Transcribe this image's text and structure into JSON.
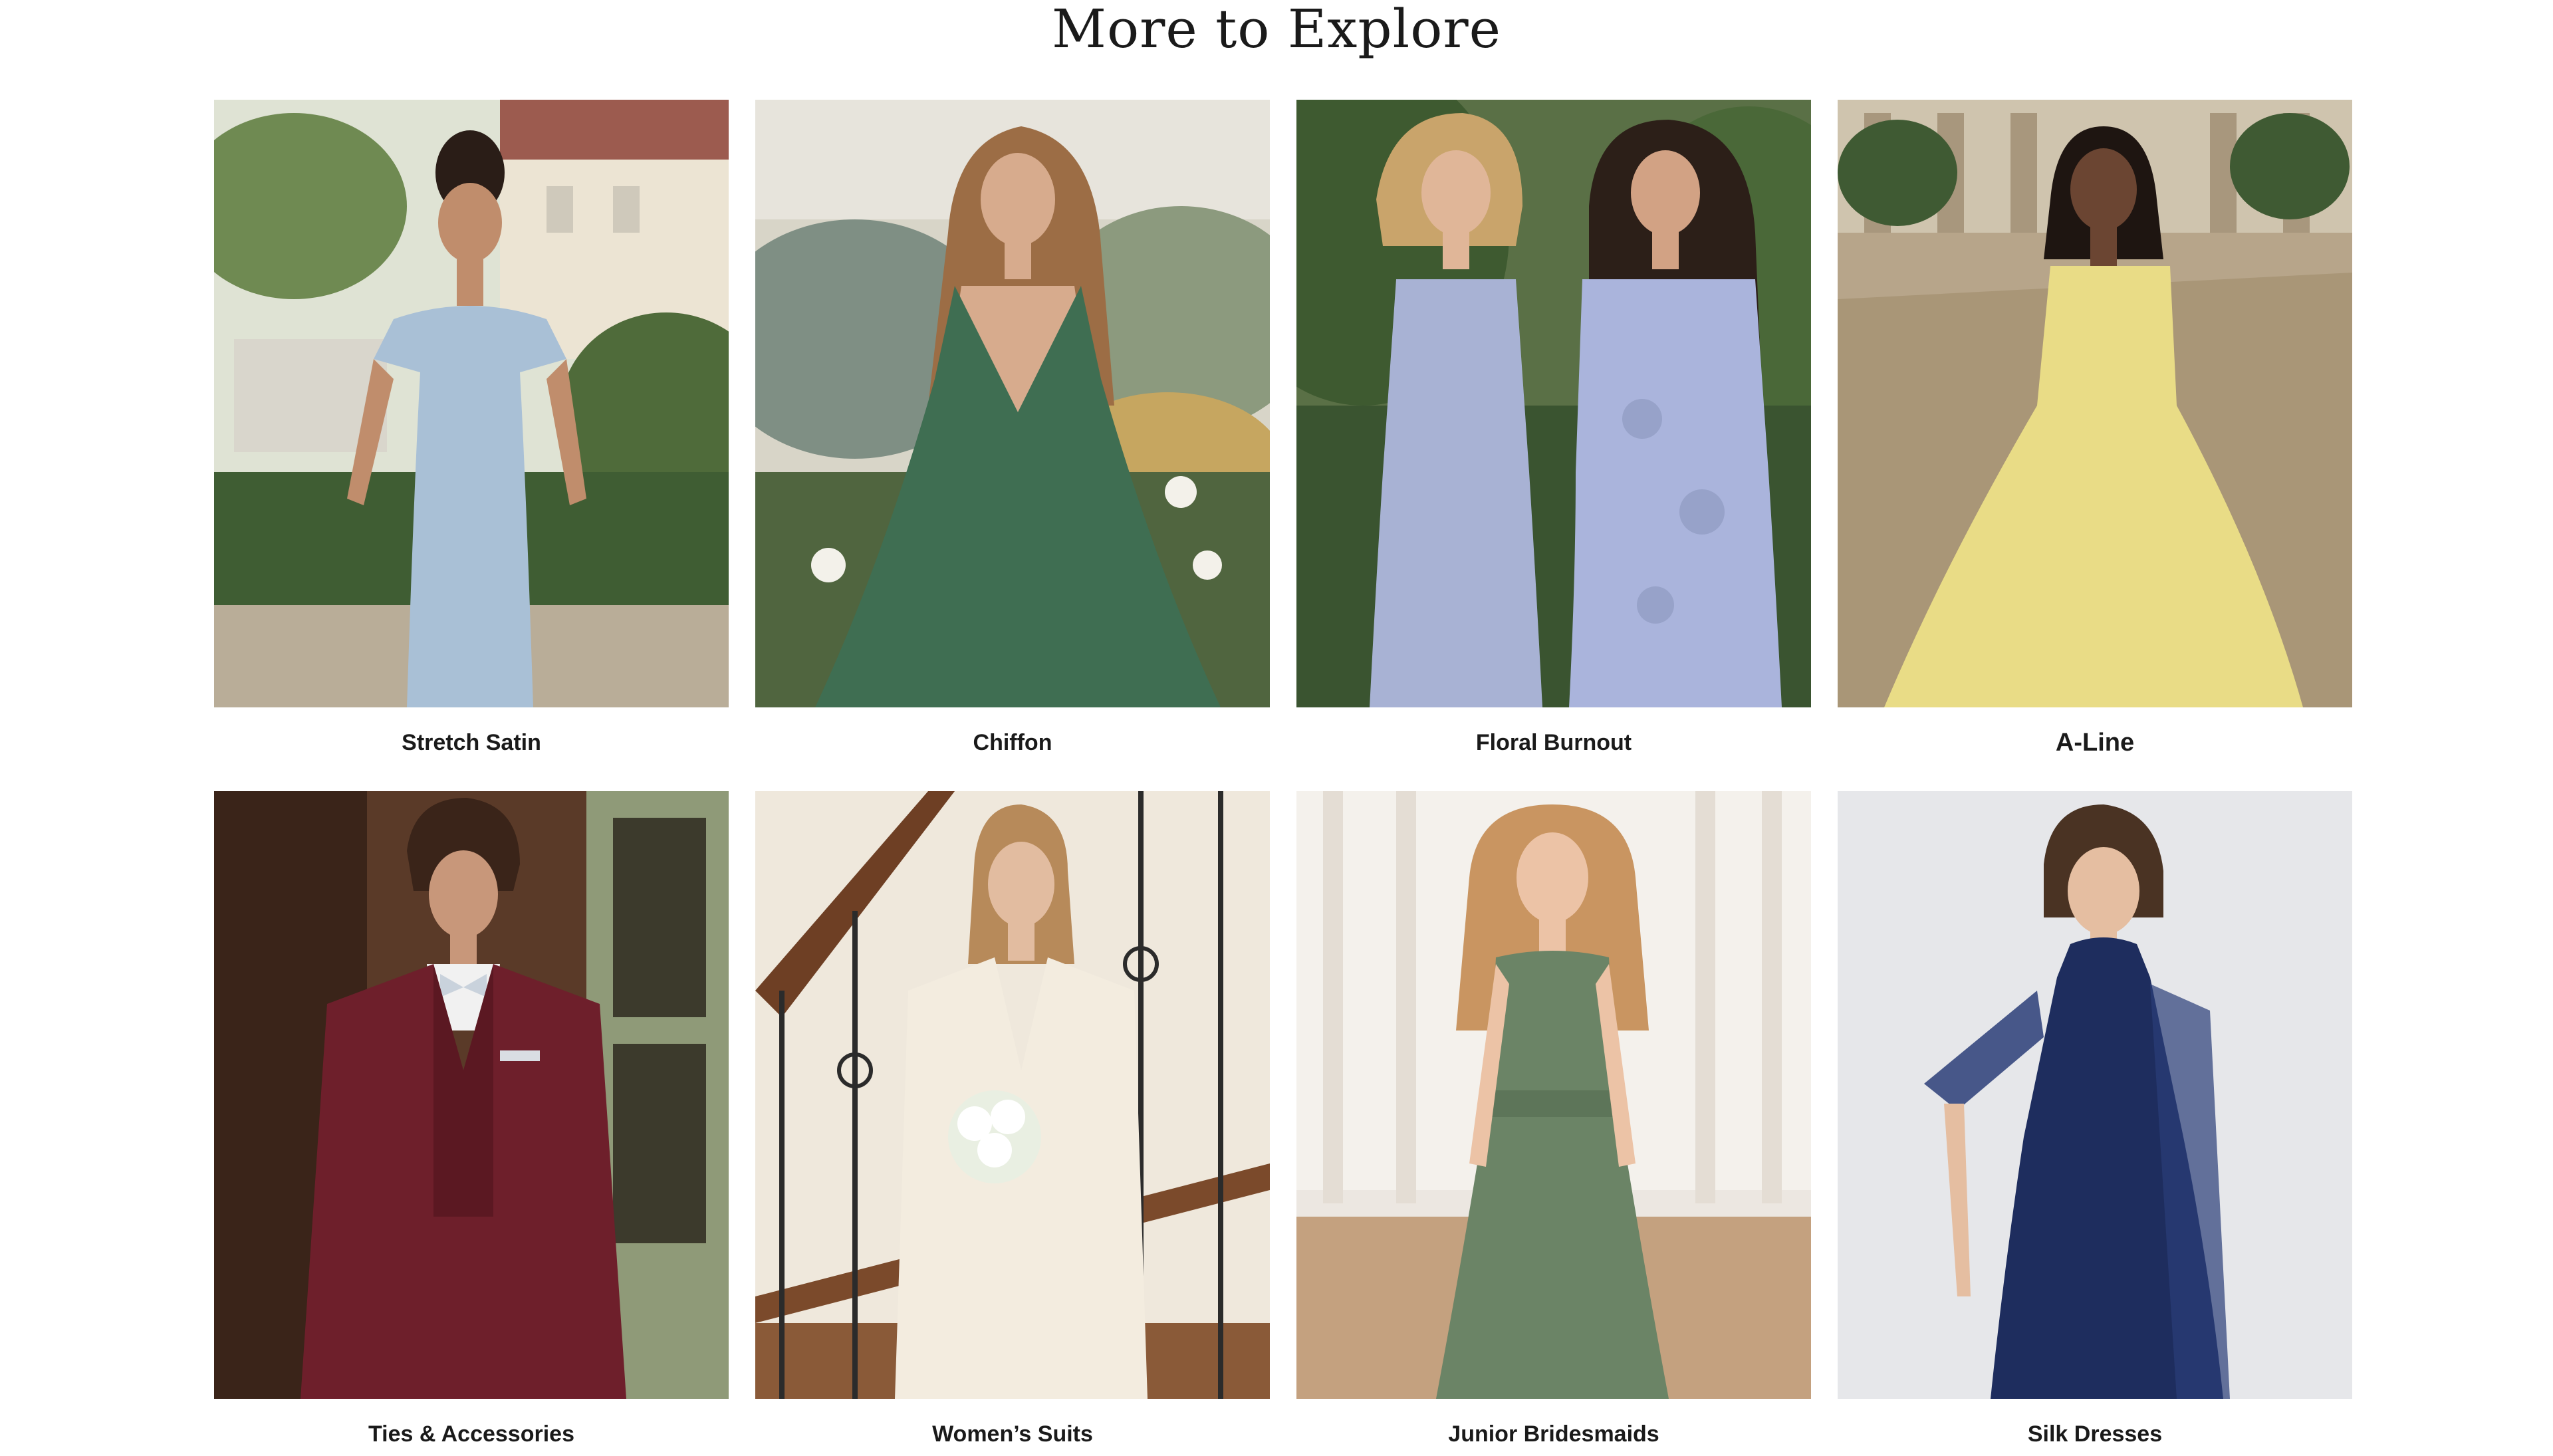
{
  "section": {
    "title": "More to Explore"
  },
  "categories": [
    {
      "label": "Stretch Satin",
      "dress_color": "#a9c0d6"
    },
    {
      "label": "Chiffon",
      "dress_color": "#3f6e52"
    },
    {
      "label": "Floral Burnout",
      "dress_color": "#a8b2d4"
    },
    {
      "label": "A-Line",
      "dress_color": "#e9dc86"
    },
    {
      "label": "Ties & Accessories",
      "dress_color": "#6e1f2b"
    },
    {
      "label": "Women’s Suits",
      "dress_color": "#efe8da"
    },
    {
      "label": "Junior Bridesmaids",
      "dress_color": "#6b8466"
    },
    {
      "label": "Silk Dresses",
      "dress_color": "#1e2d5e"
    }
  ]
}
